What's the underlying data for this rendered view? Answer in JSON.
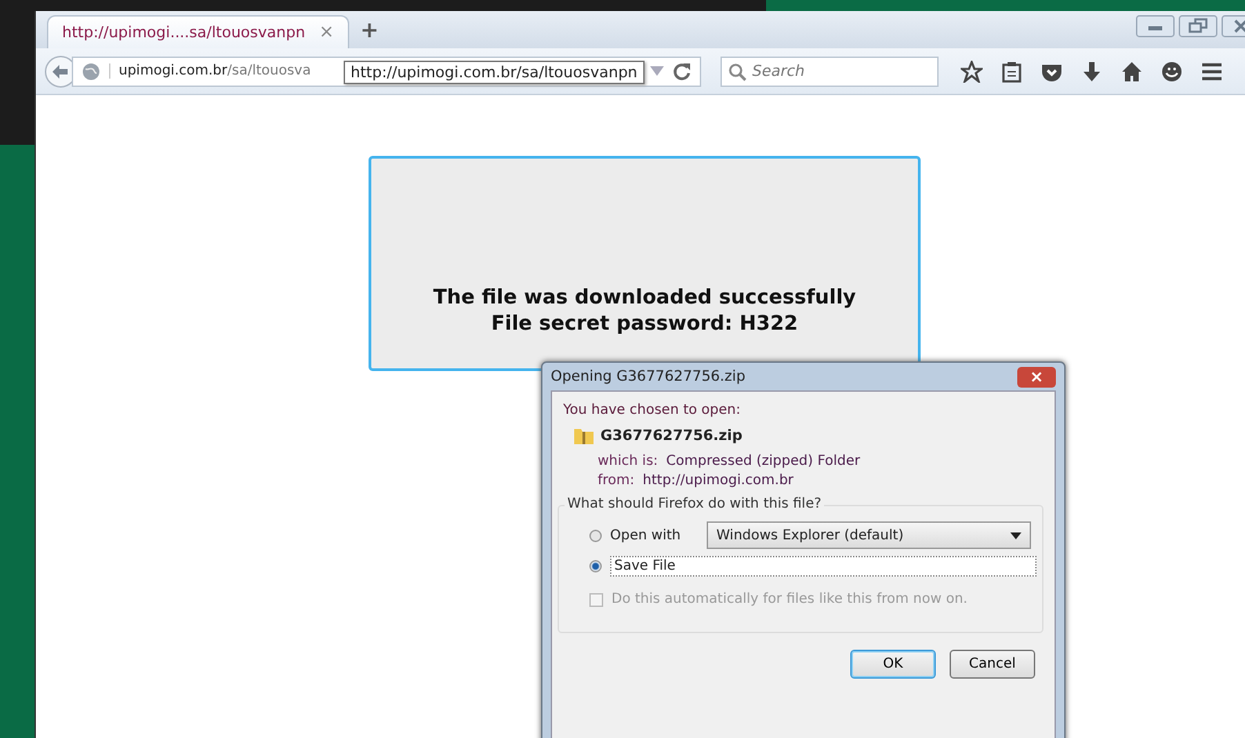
{
  "tabs": [
    {
      "label": "http://upimogi....sa/ltouosvanpn",
      "close": "×",
      "selected": true
    }
  ],
  "new_tab": "+",
  "address": {
    "domain": "upimogi.com.br",
    "path": "/sa/ltouosva"
  },
  "tooltip": "http://upimogi.com.br/sa/ltouosvanpn",
  "search": {
    "placeholder": "Search"
  },
  "message": [
    "The file was downloaded successfully",
    "File secret password: H322"
  ],
  "dialog": {
    "title": "Opening G3677627756.zip",
    "close": "×",
    "intro": "You have chosen to open:",
    "filename": "G3677627756.zip",
    "details": [
      {
        "label": "which is:",
        "value": "Compressed (zipped) Folder"
      },
      {
        "label": "from:",
        "value": "http://upimogi.com.br"
      }
    ],
    "question": "What should Firefox do with this file?",
    "options": [
      {
        "kind": "dropdown",
        "label": "Open with",
        "value": "Windows Explorer (default)",
        "selected": false
      },
      {
        "kind": "plain",
        "label": "Save File",
        "selected": true
      }
    ],
    "auto": {
      "label": "Do this automatically for files like this from now on.",
      "checked": false,
      "disabled": true
    },
    "buttons": [
      {
        "label": "OK",
        "default": true
      },
      {
        "label": "Cancel",
        "default": false
      }
    ]
  }
}
